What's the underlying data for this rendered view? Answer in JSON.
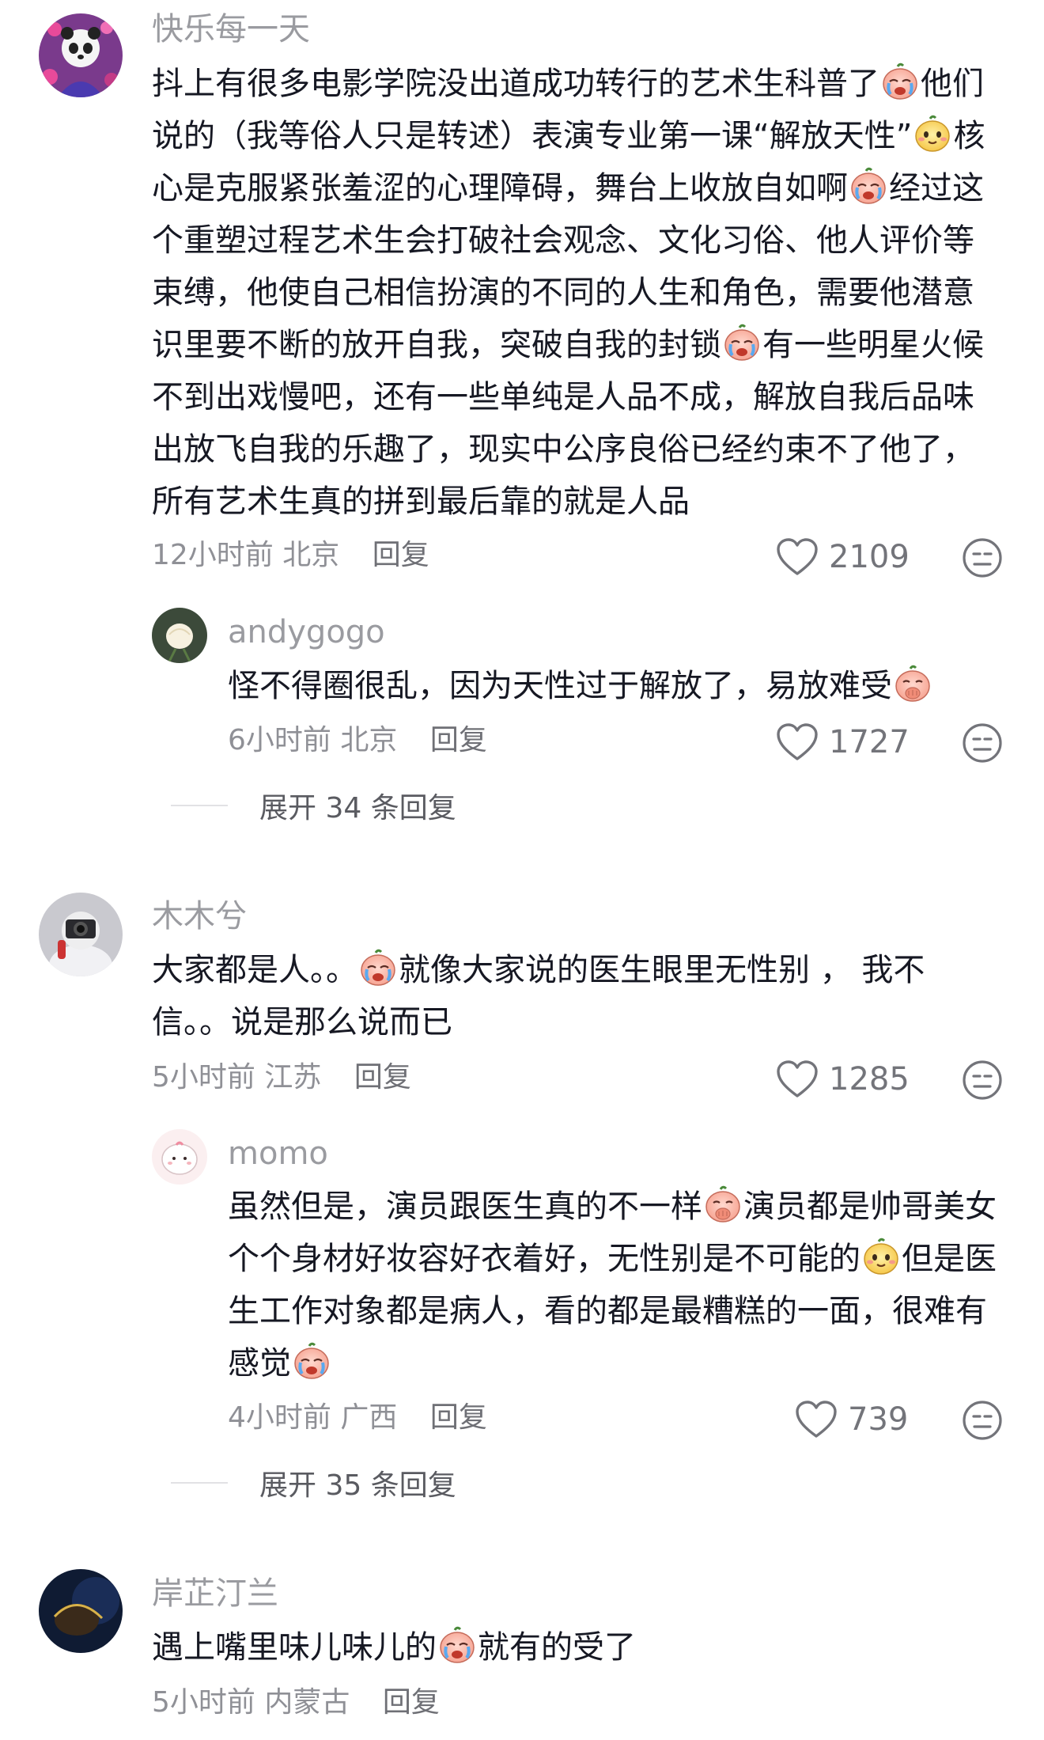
{
  "comments": [
    {
      "username": "快乐每一天",
      "text": [
        "抖上有很多电影学院没出道成功转行的艺术生科普了",
        "他们说的（我等俗人只是转述）表演专业第一课“解放天性”",
        "核心是克服紧张羞涩的心理障碍，舞台上收放自如啊",
        "经过这个重塑过程艺术生会打破社会观念、文化习俗、他人评价等束缚，他使自己相信扮演的不同的人生和角色，需要他潜意识里要不断的放开自我，突破自我的封锁",
        "有一些明星火候不到出戏慢吧，还有一些单纯是人品不成，解放自我后品味出放飞自我的乐趣了，现实中公序良俗已经约束不了他了，所有艺术生真的拼到最后靠的就是人品"
      ],
      "time": "12小时前",
      "location": "北京",
      "reply_label": "回复",
      "likes": "2109",
      "replies": [
        {
          "username": "andygogo",
          "text": [
            "怪不得圈很乱，因为天性过于解放了，易放难受"
          ],
          "time": "6小时前",
          "location": "北京",
          "reply_label": "回复",
          "likes": "1727"
        }
      ],
      "expand_label": "展开 34 条回复"
    },
    {
      "username": "木木兮",
      "text": [
        "大家都是人。。",
        "就像大家说的医生眼里无性别 ， 我不信。。说是那么说而已"
      ],
      "time": "5小时前",
      "location": "江苏",
      "reply_label": "回复",
      "likes": "1285",
      "replies": [
        {
          "username": "momo",
          "text": [
            "虽然但是，演员跟医生真的不一样",
            "演员都是帅哥美女个个身材好妆容好衣着好，无性别是不可能的",
            "但是医生工作对象都是病人，看的都是最糟糕的一面，很难有感觉"
          ],
          "time": "4小时前",
          "location": "广西",
          "reply_label": "回复",
          "likes": "739"
        }
      ],
      "expand_label": "展开 35 条回复"
    },
    {
      "username": "岸芷汀兰",
      "text": [
        "遇上嘴里味儿味儿的",
        "就有的受了"
      ],
      "time": "5小时前",
      "location": "内蒙古",
      "reply_label": "回复"
    }
  ],
  "colors": {
    "text": "#161823",
    "muted": "#9a9ba0",
    "icon": "#73747a"
  },
  "icons": [
    "heart-icon",
    "dislike-face-icon",
    "crying-emoji-icon",
    "smirk-emoji-icon",
    "covering-mouth-emoji-icon"
  ]
}
